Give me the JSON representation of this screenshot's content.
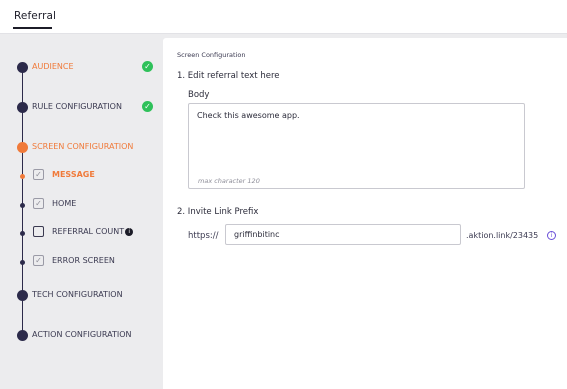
{
  "header": {
    "title": "Referral"
  },
  "steps": [
    {
      "label": "AUDIENCE",
      "active": true,
      "done": true
    },
    {
      "label": "RULE CONFIGURATION",
      "active": false,
      "done": true
    },
    {
      "label": "SCREEN CONFIGURATION",
      "active": true,
      "done": false
    },
    {
      "label": "TECH CONFIGURATION",
      "active": false,
      "done": false
    },
    {
      "label": "ACTION CONFIGURATION",
      "active": false,
      "done": false
    }
  ],
  "substeps": [
    {
      "label": "MESSAGE",
      "checked": true,
      "active": true
    },
    {
      "label": "HOME",
      "checked": true,
      "active": false
    },
    {
      "label": "REFERRAL COUNT",
      "checked": false,
      "active": false
    },
    {
      "label": "ERROR SCREEN",
      "checked": true,
      "active": false
    }
  ],
  "main": {
    "breadcrumb": "Screen Configuration",
    "section1_title": "1. Edit referral text here",
    "body_label": "Body",
    "body_value": "Check this awesome app.",
    "body_hint": "max character 120",
    "section2_title": "2. Invite Link Prefix",
    "https_label": "https://",
    "prefix_value": "griffinbitinc",
    "domain_suffix": ".aktion.link/23435"
  },
  "colors": {
    "accent": "#f07a3a",
    "step_dot": "#2c2a4a",
    "success": "#2fc15a",
    "info": "#6a4fd8"
  }
}
